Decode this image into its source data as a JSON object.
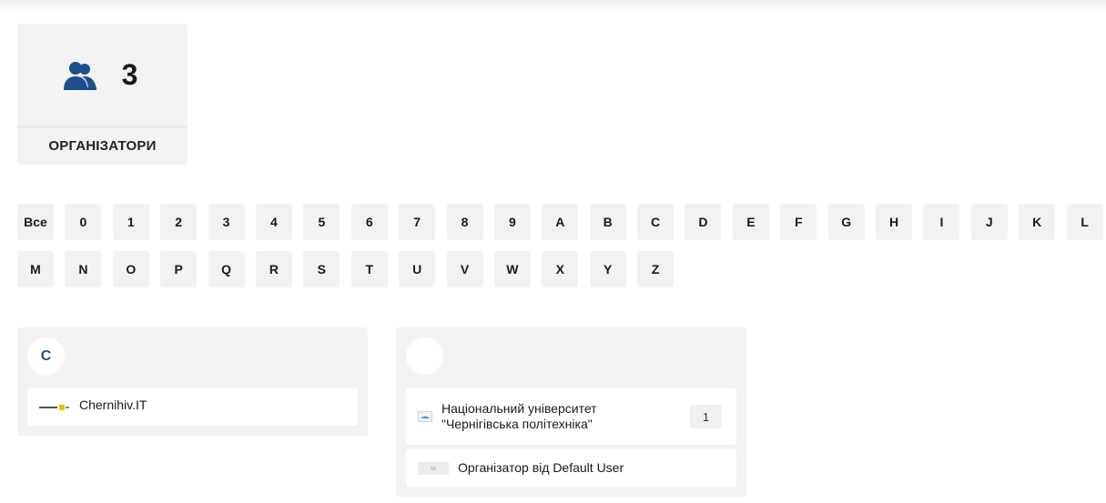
{
  "stats": {
    "count": "3",
    "label": "ОРГАНІЗАТОРИ",
    "icon": "users-icon"
  },
  "alphabet": {
    "row1": [
      "Все",
      "0",
      "1",
      "2",
      "3",
      "4",
      "5",
      "6",
      "7",
      "8",
      "9",
      "A",
      "B",
      "C",
      "D",
      "E",
      "F",
      "G",
      "H",
      "I",
      "J",
      "K",
      "L"
    ],
    "row2": [
      "M",
      "N",
      "O",
      "P",
      "Q",
      "R",
      "S",
      "T",
      "U",
      "V",
      "W",
      "X",
      "Y",
      "Z"
    ]
  },
  "groups": [
    {
      "letter": "C",
      "items": [
        {
          "name": "Chernihiv.IT",
          "logo": "chernihiv-it-logo"
        }
      ]
    },
    {
      "letter": "",
      "items": [
        {
          "name": "Національний університет\n\"Чернігівська політехніка\"",
          "count": "1",
          "logo": "university-logo"
        },
        {
          "name": "Організатор від Default User",
          "logo": "placeholder-logo"
        }
      ]
    }
  ],
  "colors": {
    "accent": "#1f4f8a",
    "card_bg": "#f3f3f3",
    "button_bg": "#f2f2f2"
  }
}
